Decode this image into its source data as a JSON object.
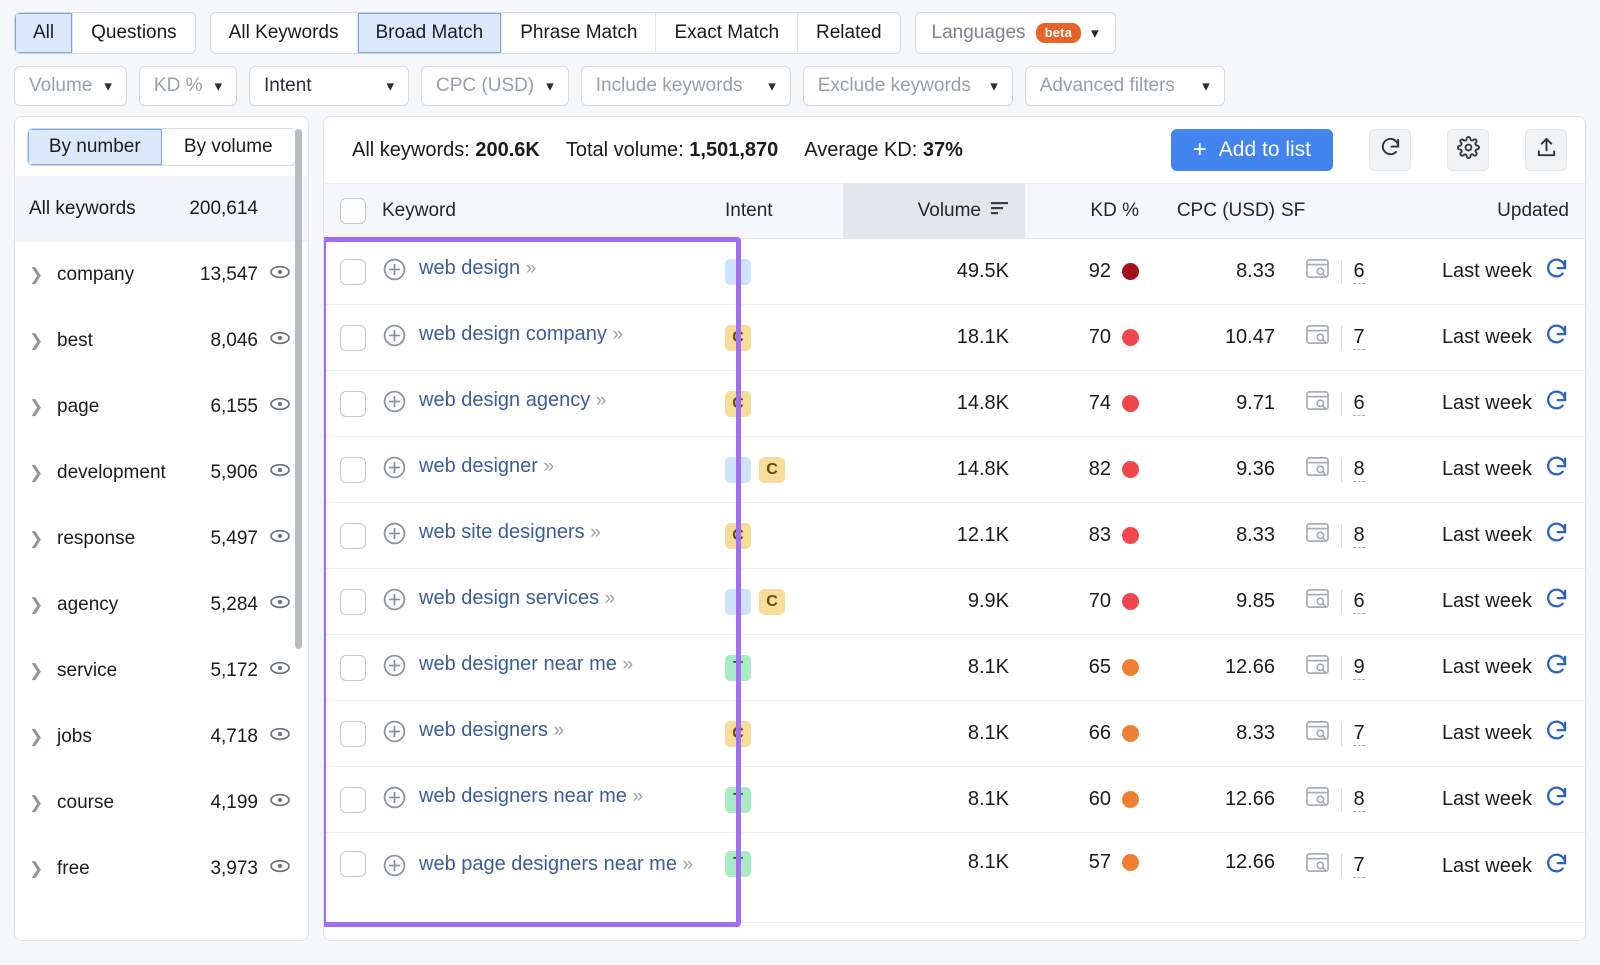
{
  "topbar": {
    "match_tabs": [
      {
        "label": "All",
        "active": true
      },
      {
        "label": "Questions",
        "active": false
      }
    ],
    "keyword_tabs": [
      {
        "label": "All Keywords",
        "active": false
      },
      {
        "label": "Broad Match",
        "active": true
      },
      {
        "label": "Phrase Match",
        "active": false
      },
      {
        "label": "Exact Match",
        "active": false
      },
      {
        "label": "Related",
        "active": false
      }
    ],
    "languages": {
      "label": "Languages",
      "badge": "beta",
      "icon": "chevron-down-icon"
    }
  },
  "filters": [
    {
      "label": "Volume",
      "muted": true
    },
    {
      "label": "KD %",
      "muted": true
    },
    {
      "label": "Intent",
      "muted": false
    },
    {
      "label": "CPC (USD)",
      "muted": true
    },
    {
      "label": "Include keywords",
      "muted": true
    },
    {
      "label": "Exclude keywords",
      "muted": true
    },
    {
      "label": "Advanced filters",
      "muted": true
    }
  ],
  "sidebar": {
    "toggle": [
      {
        "label": "By number",
        "active": true
      },
      {
        "label": "By volume",
        "active": false
      }
    ],
    "all_row": {
      "label": "All keywords",
      "count": "200,614"
    },
    "groups": [
      {
        "label": "company",
        "count": "13,547",
        "icon": "eye-icon",
        "arrow": "chevron-right-icon"
      },
      {
        "label": "best",
        "count": "8,046",
        "icon": "eye-icon",
        "arrow": "chevron-right-icon"
      },
      {
        "label": "page",
        "count": "6,155",
        "icon": "eye-icon",
        "arrow": "chevron-right-icon"
      },
      {
        "label": "development",
        "count": "5,906",
        "icon": "eye-icon",
        "arrow": "chevron-right-icon"
      },
      {
        "label": "response",
        "count": "5,497",
        "icon": "eye-icon",
        "arrow": "chevron-right-icon"
      },
      {
        "label": "agency",
        "count": "5,284",
        "icon": "eye-icon",
        "arrow": "chevron-right-icon"
      },
      {
        "label": "service",
        "count": "5,172",
        "icon": "eye-icon",
        "arrow": "chevron-right-icon"
      },
      {
        "label": "jobs",
        "count": "4,718",
        "icon": "eye-icon",
        "arrow": "chevron-right-icon"
      },
      {
        "label": "course",
        "count": "4,199",
        "icon": "eye-icon",
        "arrow": "chevron-right-icon"
      },
      {
        "label": "free",
        "count": "3,973",
        "icon": "eye-icon",
        "arrow": "chevron-right-icon"
      }
    ]
  },
  "summary": {
    "all_keywords_label": "All keywords:",
    "all_keywords_value": "200.6K",
    "total_volume_label": "Total volume:",
    "total_volume_value": "1,501,870",
    "average_kd_label": "Average KD:",
    "average_kd_value": "37%",
    "add_to_list": "Add to list",
    "add_plus": "+",
    "refresh_icon": "refresh-icon",
    "settings_icon": "gear-icon",
    "export_icon": "export-icon"
  },
  "table": {
    "headers": {
      "keyword": "Keyword",
      "intent": "Intent",
      "volume": "Volume",
      "kd": "KD %",
      "cpc": "CPC (USD)",
      "sf": "SF",
      "updated": "Updated"
    },
    "sort_icon": "sort-descending-icon",
    "rows": [
      {
        "keyword": "web design",
        "intent": [
          "I"
        ],
        "volume": "49.5K",
        "kd": "92",
        "kd_color": "#a30f1e",
        "cpc": "8.33",
        "sf": "6",
        "updated": "Last week"
      },
      {
        "keyword": "web design company",
        "intent": [
          "C"
        ],
        "volume": "18.1K",
        "kd": "70",
        "kd_color": "#f1474c",
        "cpc": "10.47",
        "sf": "7",
        "updated": "Last week"
      },
      {
        "keyword": "web design agency",
        "intent": [
          "C"
        ],
        "volume": "14.8K",
        "kd": "74",
        "kd_color": "#f1474c",
        "cpc": "9.71",
        "sf": "6",
        "updated": "Last week"
      },
      {
        "keyword": "web designer",
        "intent": [
          "I",
          "C"
        ],
        "volume": "14.8K",
        "kd": "82",
        "kd_color": "#f1474c",
        "cpc": "9.36",
        "sf": "8",
        "updated": "Last week"
      },
      {
        "keyword": "web site designers",
        "intent": [
          "C"
        ],
        "volume": "12.1K",
        "kd": "83",
        "kd_color": "#f1474c",
        "cpc": "8.33",
        "sf": "8",
        "updated": "Last week"
      },
      {
        "keyword": "web design services",
        "intent": [
          "I",
          "C"
        ],
        "volume": "9.9K",
        "kd": "70",
        "kd_color": "#f1474c",
        "cpc": "9.85",
        "sf": "6",
        "updated": "Last week"
      },
      {
        "keyword": "web designer near me",
        "intent": [
          "T"
        ],
        "volume": "8.1K",
        "kd": "65",
        "kd_color": "#ef8033",
        "cpc": "12.66",
        "sf": "9",
        "updated": "Last week"
      },
      {
        "keyword": "web designers",
        "intent": [
          "C"
        ],
        "volume": "8.1K",
        "kd": "66",
        "kd_color": "#ef8033",
        "cpc": "8.33",
        "sf": "7",
        "updated": "Last week"
      },
      {
        "keyword": "web designers near me",
        "intent": [
          "T"
        ],
        "volume": "8.1K",
        "kd": "60",
        "kd_color": "#ef8033",
        "cpc": "12.66",
        "sf": "8",
        "updated": "Last week"
      },
      {
        "keyword": "web page designers near me",
        "intent": [
          "T"
        ],
        "volume": "8.1K",
        "kd": "57",
        "kd_color": "#ef8033",
        "cpc": "12.66",
        "sf": "7",
        "updated": "Last week"
      }
    ],
    "row_icons": {
      "add_icon": "plus-circle-icon",
      "expand_chevrons": "»",
      "serp_icon": "serp-preview-icon",
      "update_icon": "refresh-icon",
      "checkbox": "checkbox"
    }
  },
  "annotation": {
    "highlight_color": "#a06ef0",
    "name": "keyword-column-highlight"
  }
}
